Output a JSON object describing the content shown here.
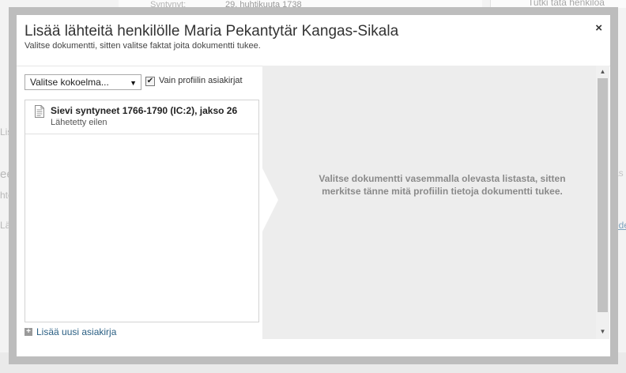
{
  "background": {
    "birth_label": "Syntynyt:",
    "birth_value": "29. huhtikuuta 1738",
    "search_text": "Tutki tätä henkilöä",
    "left_fragments": [
      "Lis",
      "ee",
      "hte",
      "Lä"
    ],
    "right_fragments": [
      "äs",
      "ede"
    ]
  },
  "modal": {
    "title": "Lisää lähteitä henkilölle Maria Pekantytär Kangas-Sikala",
    "subtitle": "Valitse dokumentti, sitten valitse faktat joita dokumentti tukee.",
    "close_label": "×"
  },
  "left_pane": {
    "collection_select": "Valitse kokoelma...",
    "checkbox_checked": true,
    "checkbox_mark": "✔",
    "checkbox_label": "Vain profiilin asiakirjat",
    "documents": [
      {
        "title": "Sievi syntyneet 1766-1790 (IC:2), jakso 26",
        "subtitle": "Lähetetty eilen",
        "icon": "document-icon"
      }
    ],
    "add_document_label": "Lisää uusi asiakirja"
  },
  "right_pane": {
    "message": "Valitse dokumentti vasemmalla olevasta listasta, sitten merkitse tänne mitä profiilin tietoja dokumentti tukee."
  },
  "colors": {
    "link": "#2a5f83",
    "overlay_frame": "#bdbdbd",
    "right_pane_bg": "#ededed"
  }
}
